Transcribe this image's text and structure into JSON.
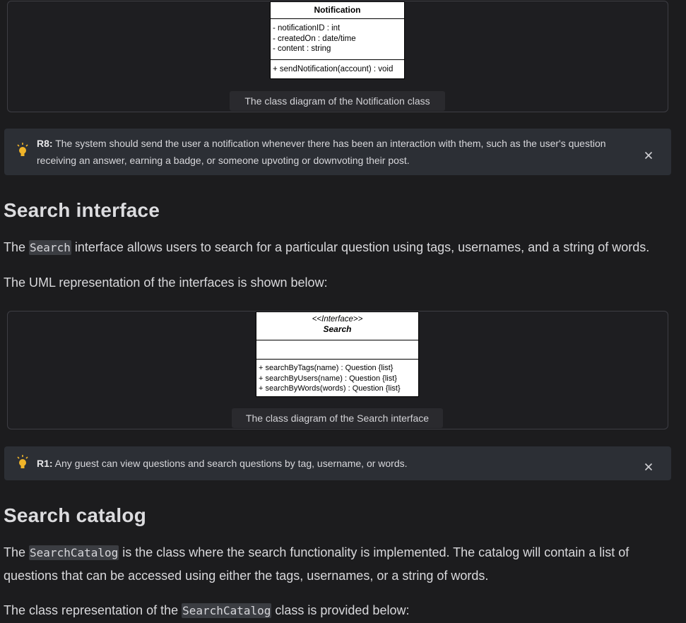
{
  "notification_figure": {
    "class_name": "Notification",
    "attributes": [
      "- notificationID : int",
      "- createdOn : date/time",
      "- content : string"
    ],
    "methods": [
      "+ sendNotification(account) : void"
    ],
    "caption": "The class diagram of the Notification class"
  },
  "callout_r8": {
    "tag": "R8:",
    "text": " The system should send the user a notification whenever there has been an interaction with them, such as the user's question receiving an answer, earning a badge, or someone upvoting or downvoting their post."
  },
  "search_interface": {
    "heading": "Search interface",
    "para1_code": "Search",
    "para1_rest": " interface allows users to search for a particular question using tags, usernames, and a string of words.",
    "para1_prefix": "The ",
    "para2": "The UML representation of the interfaces is shown below:"
  },
  "search_figure": {
    "stereotype": "<<Interface>>",
    "class_name": "Search",
    "methods": [
      "+ searchByTags(name) : Question {list}",
      "+ searchByUsers(name) : Question {list}",
      "+ searchByWords(words) : Question {list}"
    ],
    "caption": "The class diagram of the Search interface"
  },
  "callout_r1": {
    "tag": "R1:",
    "text": " Any guest can view questions and search questions by tag, username, or words."
  },
  "search_catalog": {
    "heading": "Search catalog",
    "para1_prefix": "The ",
    "para1_code": "SearchCatalog",
    "para1_rest": " is the class where the search functionality is implemented. The catalog will contain a list of questions that can be accessed using either the tags, usernames, or a string of words.",
    "para2_prefix": "The class representation of the ",
    "para2_code": "SearchCatalog",
    "para2_rest": " class is provided below:"
  },
  "icons": {
    "callout": "lightbulb-icon",
    "close": "close-icon"
  },
  "colors": {
    "bulb": "#f0b429",
    "background": "#1c1c1e",
    "callout_bg": "#2c2f35"
  }
}
